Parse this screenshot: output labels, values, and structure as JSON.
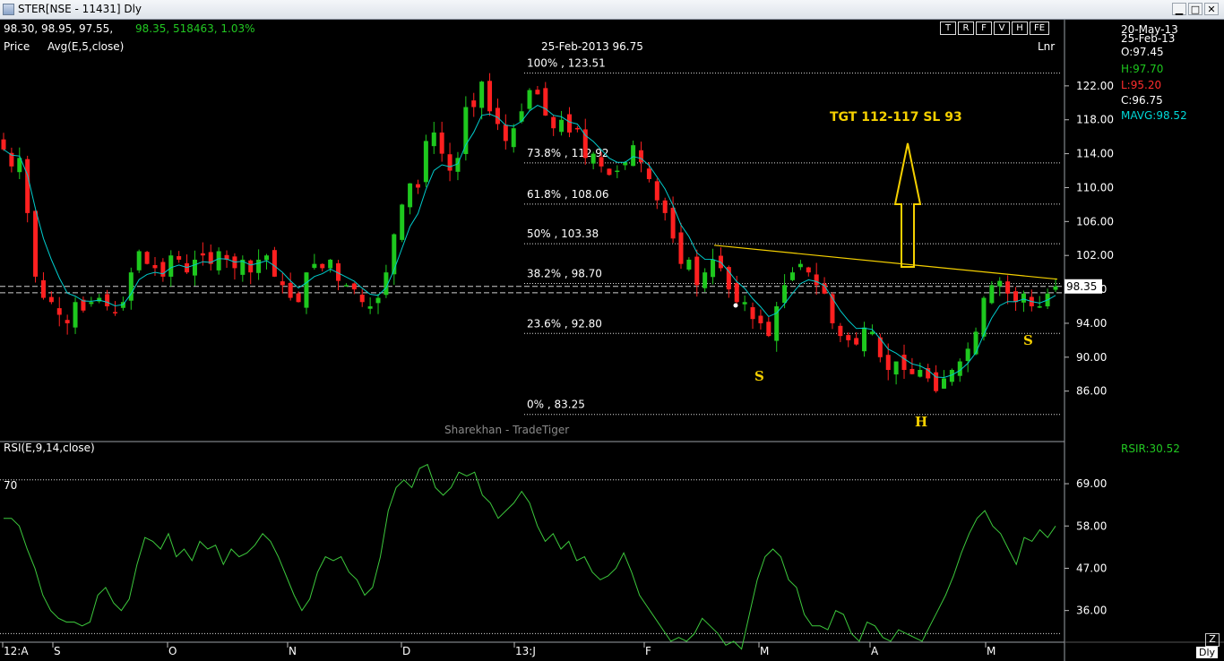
{
  "window": {
    "title": "STER[NSE - 11431] Dly",
    "buttons": [
      "▁",
      "□",
      "✕"
    ]
  },
  "toolbar": {
    "buttons": [
      "T",
      "R",
      "F",
      "V",
      "H",
      "FE"
    ],
    "scale_mode": "Lnr"
  },
  "header": {
    "ohlc_text": "98.30, 98.95, 97.55,",
    "last_text": "98.35, 518463, 1.03%",
    "price_label": "Price",
    "avg_label": "Avg(E,5,close)",
    "cursor_readout": "25-Feb-2013 96.75",
    "watermark": "Sharekhan - TradeTiger"
  },
  "info_panel": {
    "date1": "20-May-13",
    "date2": "25-Feb-13",
    "open": "O:97.45",
    "high": "H:97.70",
    "low": "L:95.20",
    "close": "C:96.75",
    "mavg": "MAVG:98.52",
    "rsi": "RSIR:30.52",
    "colors": {
      "open": "#ffffff",
      "high": "#1ec81e",
      "low": "#ff2d2d",
      "close": "#ffffff",
      "mavg": "#00d8d8",
      "rsi": "#22c822"
    }
  },
  "annotations": {
    "target_text": "TGT 112-117 SL 93",
    "pattern_labels": [
      "S",
      "H",
      "S"
    ],
    "text_color": "#f5d000"
  },
  "rsi_panel": {
    "label": "RSI(E,9,14,close)",
    "level_label": "70",
    "corner_button": "Z",
    "period_button": "Dly"
  },
  "chart_data": [
    {
      "type": "candlestick",
      "title": "STER[NSE - 11431] Dly",
      "ylim": [
        81,
        126
      ],
      "y_ticks": [
        "122.00",
        "118.00",
        "114.00",
        "110.00",
        "106.00",
        "102.00",
        "98.00",
        "94.00",
        "90.00",
        "86.00"
      ],
      "x_ticks": [
        "12:A",
        "S",
        "O",
        "N",
        "D",
        "13:J",
        "F",
        "M",
        "A",
        "M"
      ],
      "last_price": "98.35",
      "fibonacci": [
        {
          "level": "100%",
          "value": 123.51
        },
        {
          "level": "73.8%",
          "value": 112.92
        },
        {
          "level": "61.8%",
          "value": 108.06
        },
        {
          "level": "50%",
          "value": 103.38
        },
        {
          "level": "38.2%",
          "value": 98.7
        },
        {
          "level": "23.6%",
          "value": 92.8
        },
        {
          "level": "0%",
          "value": 83.25
        }
      ],
      "close": [
        114.5,
        112.5,
        113.5,
        107,
        99.5,
        97,
        96.5,
        95,
        94,
        96.5,
        95.5,
        96.5,
        97,
        96,
        95.2,
        96.5,
        100,
        102.5,
        101,
        100.5,
        99.5,
        102,
        101.5,
        100,
        101.5,
        102,
        101,
        102.5,
        101.5,
        100.5,
        101.5,
        100,
        101.5,
        102,
        99.5,
        98.5,
        97,
        96.5,
        100,
        101,
        100.5,
        101.5,
        99,
        98.5,
        98,
        96.5,
        96,
        97,
        100,
        104.5,
        108,
        110.5,
        110,
        115.5,
        116.5,
        114,
        112,
        113.5,
        119.5,
        119.5,
        122.5,
        119,
        117.5,
        115.5,
        117,
        119,
        121.5,
        121,
        118.5,
        117,
        118,
        116.5,
        117,
        113.5,
        114,
        112.5,
        111.5,
        112,
        113,
        115,
        113,
        111,
        108.5,
        107,
        104,
        101,
        101.5,
        98.5,
        100,
        101.5,
        100.5,
        98,
        96.5,
        96.5,
        94.5,
        94,
        92.5,
        96,
        98.5,
        100,
        101,
        100,
        98.5,
        97.5,
        94,
        92.5,
        92,
        91.5,
        93.5,
        93,
        90,
        88.5,
        89.5,
        88.5,
        88,
        88.5,
        87.5,
        86,
        87.5,
        88.5,
        89.5,
        91,
        93,
        97,
        98.5,
        99,
        97.5,
        96.5,
        97.5,
        96,
        96,
        97.5,
        98.35
      ],
      "volume": [
        518463
      ],
      "series": [
        {
          "name": "Avg(E,5,close)",
          "color": "#00cccc"
        }
      ],
      "colors": {
        "up": "#1ec81e",
        "down": "#ff2020",
        "fib": "#ffffff",
        "trendline": "#f5d000"
      }
    },
    {
      "type": "line",
      "title": "RSI(E,9,14,close)",
      "ylim": [
        28,
        76
      ],
      "y_ticks": [
        "69.00",
        "58.00",
        "47.00",
        "36.00"
      ],
      "overbought": 70,
      "oversold": 30,
      "values": [
        60,
        60,
        58,
        52,
        47,
        40,
        36,
        34,
        33,
        33,
        32,
        33,
        40,
        42,
        38,
        36,
        39,
        48,
        55,
        54,
        52,
        56,
        50,
        52,
        49,
        54,
        52,
        53,
        48,
        52,
        50,
        51,
        53,
        56,
        54,
        50,
        45,
        40,
        36,
        39,
        46,
        50,
        49,
        50,
        46,
        44,
        40,
        42,
        50,
        62,
        68,
        70,
        68,
        73,
        74,
        68,
        66,
        68,
        72,
        71,
        72,
        66,
        64,
        60,
        62,
        64,
        67,
        64,
        58,
        54,
        56,
        52,
        54,
        49,
        50,
        46,
        44,
        45,
        47,
        51,
        46,
        40,
        37,
        34,
        31,
        28,
        29,
        28,
        30,
        34,
        32,
        30,
        27,
        28,
        26,
        35,
        44,
        50,
        52,
        50,
        44,
        42,
        35,
        32,
        32,
        31,
        36,
        35,
        30,
        28,
        33,
        32,
        29,
        28,
        31,
        30,
        29,
        28,
        32,
        36,
        40,
        45,
        51,
        56,
        60,
        62,
        58,
        56,
        52,
        48,
        55,
        54,
        57,
        55,
        58
      ]
    }
  ]
}
